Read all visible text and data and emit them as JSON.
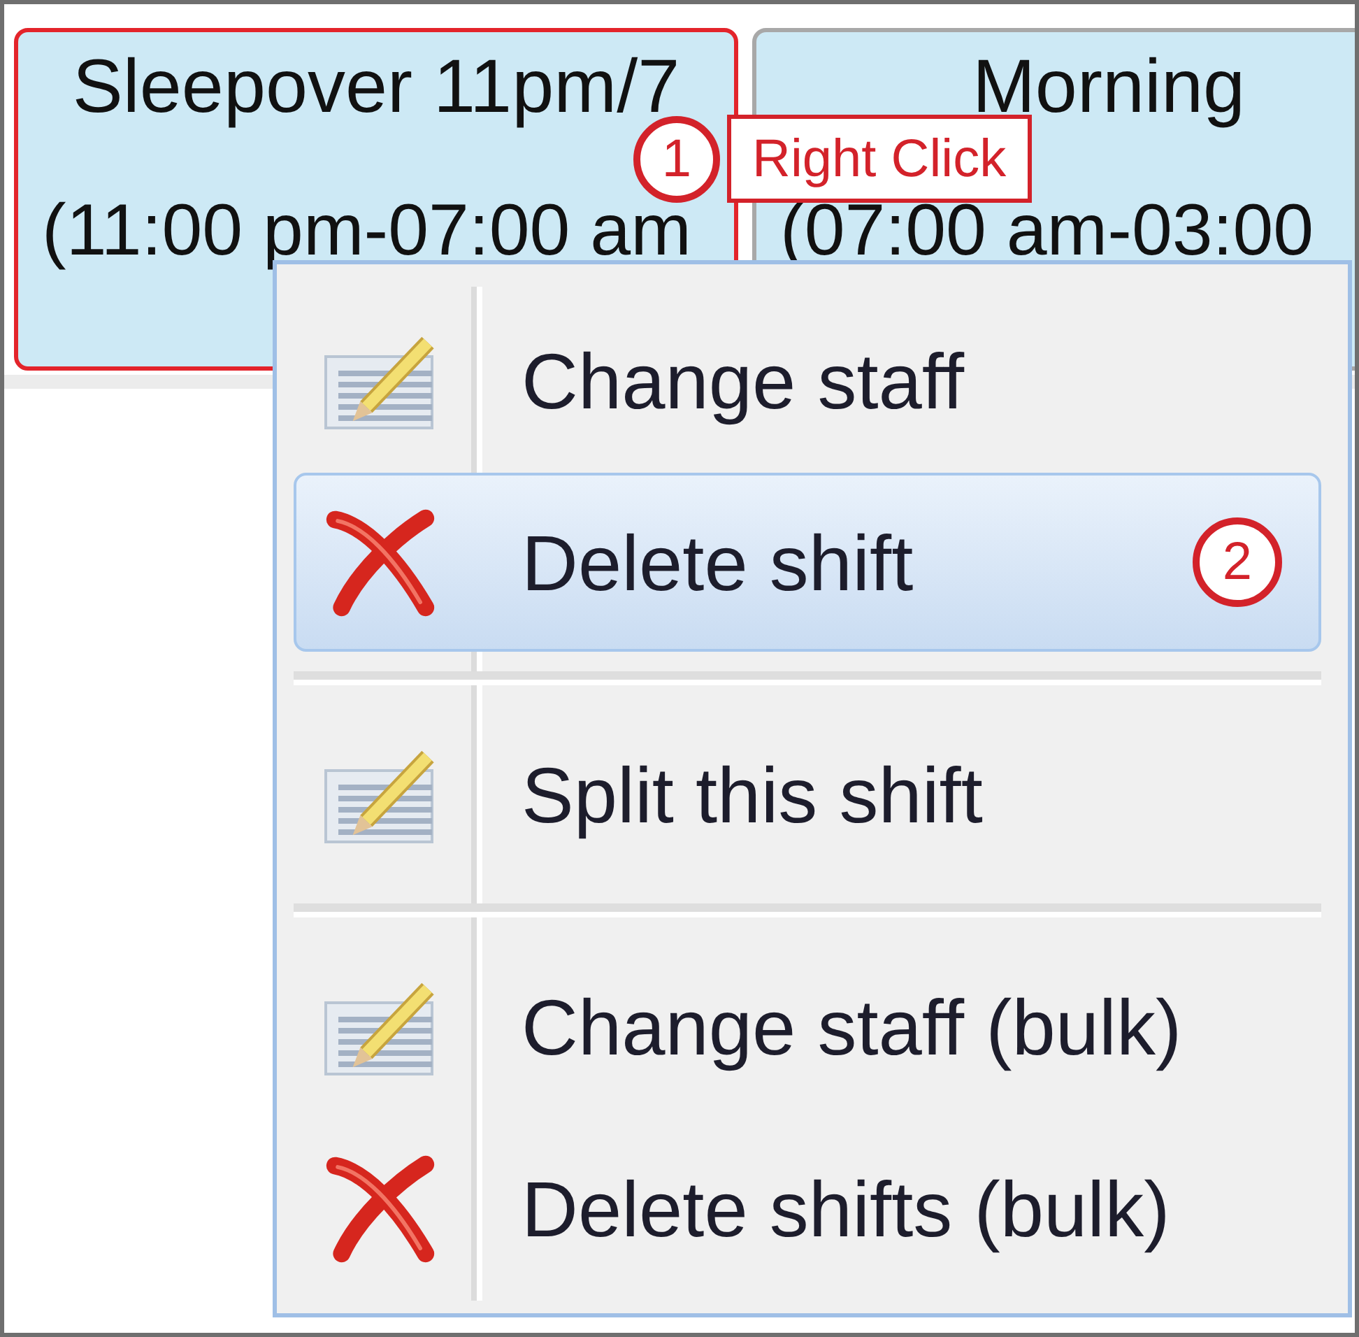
{
  "shifts": [
    {
      "title": "Sleepover 11pm/7",
      "time": "(11:00 pm-07:00 am",
      "selected": true,
      "callout": {
        "number": "1",
        "label": "Right Click"
      }
    },
    {
      "title": "Morning",
      "time": "(07:00 am-03:00",
      "selected": false
    }
  ],
  "context_menu": {
    "items": [
      {
        "kind": "edit",
        "label": "Change staff",
        "selected": false
      },
      {
        "kind": "delete",
        "label": "Delete shift",
        "selected": true,
        "callout": {
          "number": "2"
        }
      },
      {
        "kind": "separator"
      },
      {
        "kind": "edit",
        "label": "Split this shift",
        "selected": false
      },
      {
        "kind": "separator"
      },
      {
        "kind": "edit",
        "label": "Change staff (bulk)",
        "selected": false
      },
      {
        "kind": "delete",
        "label": "Delete shifts (bulk)",
        "selected": false
      }
    ]
  }
}
